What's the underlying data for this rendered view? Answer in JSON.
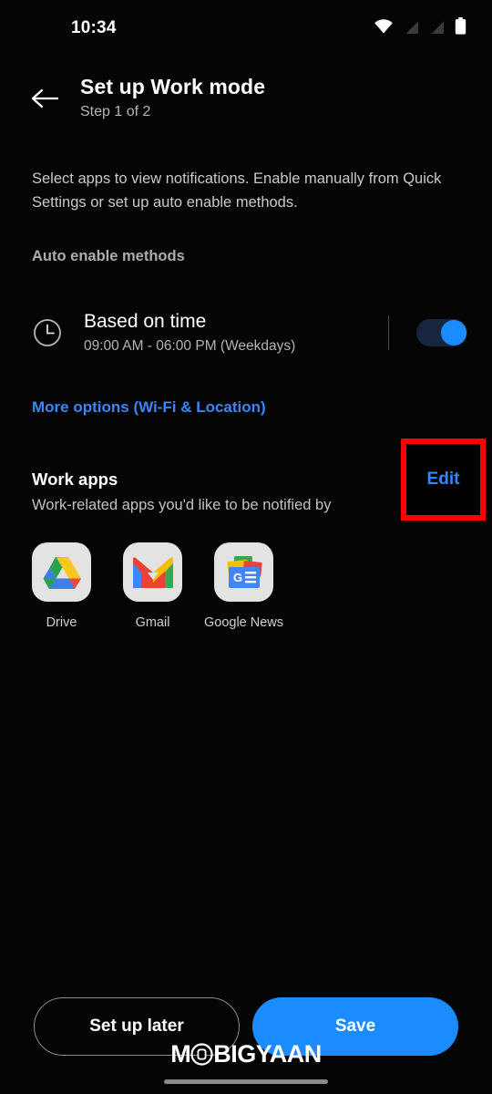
{
  "status_bar": {
    "time": "10:34",
    "icons": [
      "wifi-icon",
      "sim-off-icon",
      "sim-off-icon",
      "battery-icon"
    ]
  },
  "header": {
    "back_icon": "back-arrow-icon",
    "title": "Set up Work mode",
    "step": "Step 1 of 2"
  },
  "body": {
    "description": "Select apps to view notifications. Enable manually from Quick Settings or set up auto enable methods.",
    "auto_enable_label": "Auto enable methods"
  },
  "time_rule": {
    "icon": "clock-icon",
    "title": "Based on time",
    "schedule": "09:00 AM - 06:00 PM (Weekdays)",
    "toggle_state": "on"
  },
  "more_options": {
    "label": "More options (Wi-Fi & Location)",
    "color": "#3b86f7"
  },
  "work_apps": {
    "title": "Work apps",
    "subtitle": "Work-related apps you'd like to be notified by",
    "edit_label": "Edit",
    "edit_color": "#2f88ff",
    "highlight_color": "#fe0000",
    "apps": [
      {
        "name": "Drive",
        "icon": "google-drive-icon"
      },
      {
        "name": "Gmail",
        "icon": "gmail-icon"
      },
      {
        "name": "Google News",
        "icon": "google-news-icon"
      }
    ]
  },
  "footer": {
    "secondary_label": "Set up later",
    "primary_label": "Save",
    "primary_color": "#1a8cff"
  },
  "watermark": {
    "text_before": "M",
    "text_after": "BIGYAAN"
  }
}
